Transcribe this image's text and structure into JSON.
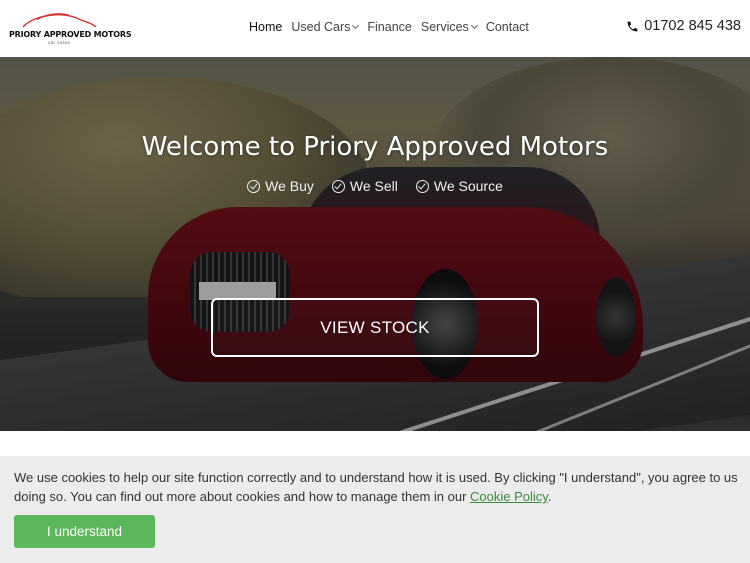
{
  "brand": {
    "name": "PRIORY APPROVED MOTORS",
    "tagline": "car sales",
    "accent_color": "#d32f2f"
  },
  "nav": {
    "items": [
      {
        "label": "Home",
        "active": true,
        "dropdown": false
      },
      {
        "label": "Used Cars",
        "active": false,
        "dropdown": true
      },
      {
        "label": "Finance",
        "active": false,
        "dropdown": false
      },
      {
        "label": "Services",
        "active": false,
        "dropdown": true
      },
      {
        "label": "Contact",
        "active": false,
        "dropdown": false
      }
    ]
  },
  "phone": {
    "icon": "phone-icon",
    "number": "01702 845 438"
  },
  "hero": {
    "title": "Welcome to Priory Approved Motors",
    "features": [
      {
        "icon": "check-circle-icon",
        "label": "We Buy"
      },
      {
        "icon": "check-circle-icon",
        "label": "We Sell"
      },
      {
        "icon": "check-circle-icon",
        "label": "We Source"
      }
    ],
    "cta_label": "VIEW STOCK"
  },
  "cookie_banner": {
    "text_before_link": "We use cookies to help our site function correctly and to understand how it is used. By clicking \"I understand\", you agree to us doing so. You can find out more about cookies and how to manage them in our ",
    "link_label": "Cookie Policy",
    "text_after_link": ".",
    "button_label": "I understand",
    "button_color": "#5bb75b",
    "link_color": "#3c8a3c"
  }
}
